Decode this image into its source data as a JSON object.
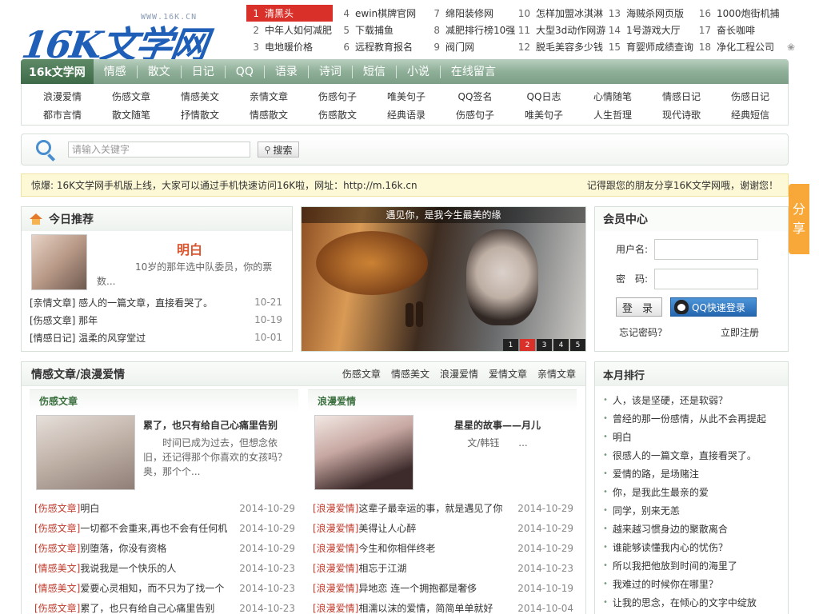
{
  "logo": {
    "url_text": "WWW.16K.CN",
    "text": "16K文学网"
  },
  "hotlist": [
    [
      {
        "n": "1",
        "t": "清黑头"
      },
      {
        "n": "4",
        "t": "ewin棋牌官网"
      },
      {
        "n": "7",
        "t": "绵阳装修网"
      },
      {
        "n": "10",
        "t": "怎样加盟冰淇淋"
      },
      {
        "n": "13",
        "t": "海贼杀网页版"
      },
      {
        "n": "16",
        "t": "1000炮街机捕"
      }
    ],
    [
      {
        "n": "2",
        "t": "中年人如何减肥"
      },
      {
        "n": "5",
        "t": "下载捕鱼"
      },
      {
        "n": "8",
        "t": "减肥排行榜10强"
      },
      {
        "n": "11",
        "t": "大型3d动作网游"
      },
      {
        "n": "14",
        "t": "1号游戏大厅"
      },
      {
        "n": "17",
        "t": "奋长咖啡"
      }
    ],
    [
      {
        "n": "3",
        "t": "电地暖价格"
      },
      {
        "n": "6",
        "t": "远程教育报名"
      },
      {
        "n": "9",
        "t": "阀门网"
      },
      {
        "n": "12",
        "t": "脱毛美容多少钱"
      },
      {
        "n": "15",
        "t": "育婴师成绩查询"
      },
      {
        "n": "18",
        "t": "净化工程公司"
      }
    ]
  ],
  "nav": {
    "home": "16k文学网",
    "items": [
      "情感",
      "散文",
      "日记",
      "QQ",
      "语录",
      "诗词",
      "短信",
      "小说",
      "在线留言"
    ]
  },
  "subnav": [
    [
      "浪漫爱情",
      "伤感文章",
      "情感美文",
      "亲情文章",
      "伤感句子",
      "唯美句子",
      "QQ签名",
      "QQ日志",
      "心情随笔",
      "情感日记",
      "伤感日记"
    ],
    [
      "都市言情",
      "散文随笔",
      "抒情散文",
      "情感散文",
      "伤感散文",
      "经典语录",
      "伤感句子",
      "唯美句子",
      "人生哲理",
      "现代诗歌",
      "经典短信"
    ]
  ],
  "search": {
    "placeholder": "请输入关键字",
    "button": "搜索"
  },
  "notice": {
    "left": "惊爆: 16K文学网手机版上线，大家可以通过手机快速访问16K啦，网址：http://m.16k.cn",
    "right": "记得跟您的朋友分享16K文学网哦，谢谢您！"
  },
  "share": {
    "label1": "分",
    "label2": "享"
  },
  "today": {
    "title": "今日推荐",
    "feature_title": "明白",
    "feature_desc": "10岁的那年选中队委员，你的票数...",
    "list": [
      {
        "text": "[亲情文章] 感人的一篇文章，直接看哭了。",
        "date": "10-21"
      },
      {
        "text": "[伤感文章] 那年",
        "date": "10-19"
      },
      {
        "text": "[情感日记] 温柔的风穿堂过",
        "date": "10-01"
      }
    ]
  },
  "banner": {
    "caption": "遇见你，是我今生最美的缘",
    "dots": [
      "1",
      "2",
      "3",
      "4",
      "5"
    ],
    "active": "2"
  },
  "member": {
    "title": "会员中心",
    "user_label": "用户名:",
    "pass_label": "密　码:",
    "login": "登 录",
    "qq_login": "QQ快速登录",
    "forgot": "忘记密码？",
    "register": "立即注册"
  },
  "main": {
    "title": "情感文章/浪漫爱情",
    "tabs": [
      "伤感文章",
      "情感美文",
      "浪漫爱情",
      "爱情文章",
      "亲情文章"
    ],
    "left": {
      "head": "伤感文章",
      "feature_title": "累了，也只有给自己心痛里告别",
      "feature_desc": "时间已成为过去，但想念依旧，还记得那个你喜欢的女孩吗？奥，那个个...",
      "rows": [
        {
          "cat": "[伤感文章]",
          "title": "明白",
          "date": "2014-10-29"
        },
        {
          "cat": "[伤感文章]",
          "title": "一切都不会重来,再也不会有任何机",
          "date": "2014-10-29"
        },
        {
          "cat": "[伤感文章]",
          "title": "别堕落，你没有资格",
          "date": "2014-10-29"
        },
        {
          "cat": "[情感美文]",
          "title": "我说我是一个快乐的人",
          "date": "2014-10-23"
        },
        {
          "cat": "[情感美文]",
          "title": "爱要心灵相知，而不只为了找一个",
          "date": "2014-10-23"
        },
        {
          "cat": "[伤感文章]",
          "title": "累了，也只有给自己心痛里告别",
          "date": "2014-10-23"
        }
      ]
    },
    "right": {
      "head": "浪漫爱情",
      "feature_title": "星星的故事——月儿",
      "feature_desc": "文/韩钰　　...",
      "rows": [
        {
          "cat": "[浪漫爱情]",
          "title": "这辈子最幸运的事，就是遇见了你",
          "date": "2014-10-29"
        },
        {
          "cat": "[浪漫爱情]",
          "title": "美得让人心醉",
          "date": "2014-10-29"
        },
        {
          "cat": "[浪漫爱情]",
          "title": "今生和你相伴终老",
          "date": "2014-10-29"
        },
        {
          "cat": "[浪漫爱情]",
          "title": "相忘于江湖",
          "date": "2014-10-23"
        },
        {
          "cat": "[浪漫爱情]",
          "title": "异地恋 连一个拥抱都是奢侈",
          "date": "2014-10-19"
        },
        {
          "cat": "[浪漫爱情]",
          "title": "相濡以沫的爱情，简简单单就好",
          "date": "2014-10-04"
        }
      ]
    }
  },
  "rank": {
    "title": "本月排行",
    "items": [
      "人，该是坚硬，还是软弱？",
      "曾经的那一份感情，从此不会再提起",
      "明白",
      "很感人的一篇文章，直接看哭了。",
      "爱情的路，是场赌注",
      "你，是我此生最亲的爱",
      "同学，别来无恙",
      "越来越习惯身边的聚散离合",
      "谁能够读懂我内心的忧伤？",
      "所以我把他放到时间的海里了",
      "我难过的时候你在哪里？",
      "让我的思念，在倾心的文字中绽放"
    ]
  },
  "colors": {
    "nav_green": "#7c9e86",
    "hot_red": "#d9302a",
    "accent_orange": "#d8552f",
    "share_orange": "#f7a838",
    "logo_blue": "#1f5fb8"
  }
}
